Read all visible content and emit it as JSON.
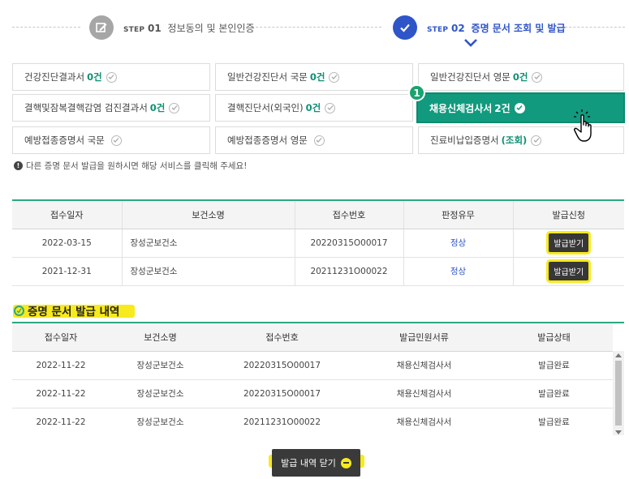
{
  "steps": [
    {
      "prefix": "STEP",
      "num": "01",
      "title": "정보동의 및 본인인증"
    },
    {
      "prefix": "STEP",
      "num": "02",
      "title": "증명 문서 조회 및 발급"
    }
  ],
  "documents": [
    {
      "label": "건강진단결과서",
      "count": "0건"
    },
    {
      "label": "일반건강진단서 국문",
      "count": "0건"
    },
    {
      "label": "일반건강진단서 영문",
      "count": "0건"
    },
    {
      "label": "결핵및잠복결핵감염 검진결과서",
      "count": "0건"
    },
    {
      "label": "결핵진단서(외국인)",
      "count": "0건"
    },
    {
      "label": "채용신체검사서",
      "count": "2건"
    },
    {
      "label": "예방접종증명서 국문",
      "count": ""
    },
    {
      "label": "예방접종증명서 영문",
      "count": ""
    },
    {
      "label": "진료비납입증명서",
      "count": "(조회)"
    }
  ],
  "badge": "1",
  "notice": "다른 증명 문서 발급을 원하시면 해당 서비스를 클릭해 주세요!",
  "result_table": {
    "headers": [
      "접수일자",
      "보건소명",
      "접수번호",
      "판정유무",
      "발급신청"
    ],
    "rows": [
      {
        "date": "2022-03-15",
        "center": "장성군보건소",
        "number": "20220315O00017",
        "result": "정상",
        "action": "발급받기"
      },
      {
        "date": "2021-12-31",
        "center": "장성군보건소",
        "number": "20211231O00022",
        "result": "정상",
        "action": "발급받기"
      }
    ]
  },
  "history": {
    "title": "증명 문서 발급 내역",
    "headers": [
      "접수일자",
      "보건소명",
      "접수번호",
      "발급민원서류",
      "발급상태"
    ],
    "rows": [
      {
        "date": "2022-11-22",
        "center": "장성군보건소",
        "number": "20220315O00017",
        "doc": "채용신체검사서",
        "status": "발급완료"
      },
      {
        "date": "2022-11-22",
        "center": "장성군보건소",
        "number": "20220315O00017",
        "doc": "채용신체검사서",
        "status": "발급완료"
      },
      {
        "date": "2022-11-22",
        "center": "장성군보건소",
        "number": "20211231O00022",
        "doc": "채용신체검사서",
        "status": "발급완료"
      }
    ]
  },
  "close_button": "발급 내역 닫기",
  "colors": {
    "accent_green": "#119a7e",
    "step_blue": "#2f55c9",
    "highlight": "#f7ea1d"
  },
  "icons": [
    "edit-icon",
    "check-circle-icon",
    "chevron-down-icon",
    "hand-pointer-icon",
    "info-icon",
    "minus-circle-icon"
  ]
}
